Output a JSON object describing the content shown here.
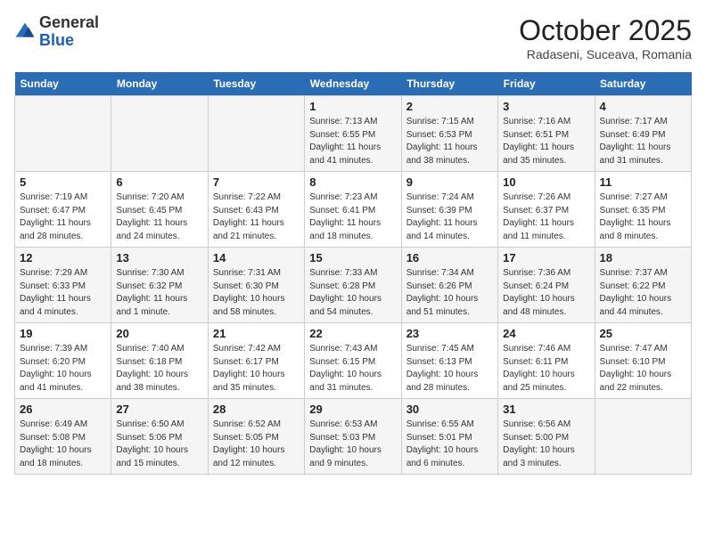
{
  "logo": {
    "general": "General",
    "blue": "Blue"
  },
  "header": {
    "month_title": "October 2025",
    "subtitle": "Radaseni, Suceava, Romania"
  },
  "weekdays": [
    "Sunday",
    "Monday",
    "Tuesday",
    "Wednesday",
    "Thursday",
    "Friday",
    "Saturday"
  ],
  "weeks": [
    [
      {
        "day": "",
        "info": ""
      },
      {
        "day": "",
        "info": ""
      },
      {
        "day": "",
        "info": ""
      },
      {
        "day": "1",
        "info": "Sunrise: 7:13 AM\nSunset: 6:55 PM\nDaylight: 11 hours\nand 41 minutes."
      },
      {
        "day": "2",
        "info": "Sunrise: 7:15 AM\nSunset: 6:53 PM\nDaylight: 11 hours\nand 38 minutes."
      },
      {
        "day": "3",
        "info": "Sunrise: 7:16 AM\nSunset: 6:51 PM\nDaylight: 11 hours\nand 35 minutes."
      },
      {
        "day": "4",
        "info": "Sunrise: 7:17 AM\nSunset: 6:49 PM\nDaylight: 11 hours\nand 31 minutes."
      }
    ],
    [
      {
        "day": "5",
        "info": "Sunrise: 7:19 AM\nSunset: 6:47 PM\nDaylight: 11 hours\nand 28 minutes."
      },
      {
        "day": "6",
        "info": "Sunrise: 7:20 AM\nSunset: 6:45 PM\nDaylight: 11 hours\nand 24 minutes."
      },
      {
        "day": "7",
        "info": "Sunrise: 7:22 AM\nSunset: 6:43 PM\nDaylight: 11 hours\nand 21 minutes."
      },
      {
        "day": "8",
        "info": "Sunrise: 7:23 AM\nSunset: 6:41 PM\nDaylight: 11 hours\nand 18 minutes."
      },
      {
        "day": "9",
        "info": "Sunrise: 7:24 AM\nSunset: 6:39 PM\nDaylight: 11 hours\nand 14 minutes."
      },
      {
        "day": "10",
        "info": "Sunrise: 7:26 AM\nSunset: 6:37 PM\nDaylight: 11 hours\nand 11 minutes."
      },
      {
        "day": "11",
        "info": "Sunrise: 7:27 AM\nSunset: 6:35 PM\nDaylight: 11 hours\nand 8 minutes."
      }
    ],
    [
      {
        "day": "12",
        "info": "Sunrise: 7:29 AM\nSunset: 6:33 PM\nDaylight: 11 hours\nand 4 minutes."
      },
      {
        "day": "13",
        "info": "Sunrise: 7:30 AM\nSunset: 6:32 PM\nDaylight: 11 hours\nand 1 minute."
      },
      {
        "day": "14",
        "info": "Sunrise: 7:31 AM\nSunset: 6:30 PM\nDaylight: 10 hours\nand 58 minutes."
      },
      {
        "day": "15",
        "info": "Sunrise: 7:33 AM\nSunset: 6:28 PM\nDaylight: 10 hours\nand 54 minutes."
      },
      {
        "day": "16",
        "info": "Sunrise: 7:34 AM\nSunset: 6:26 PM\nDaylight: 10 hours\nand 51 minutes."
      },
      {
        "day": "17",
        "info": "Sunrise: 7:36 AM\nSunset: 6:24 PM\nDaylight: 10 hours\nand 48 minutes."
      },
      {
        "day": "18",
        "info": "Sunrise: 7:37 AM\nSunset: 6:22 PM\nDaylight: 10 hours\nand 44 minutes."
      }
    ],
    [
      {
        "day": "19",
        "info": "Sunrise: 7:39 AM\nSunset: 6:20 PM\nDaylight: 10 hours\nand 41 minutes."
      },
      {
        "day": "20",
        "info": "Sunrise: 7:40 AM\nSunset: 6:18 PM\nDaylight: 10 hours\nand 38 minutes."
      },
      {
        "day": "21",
        "info": "Sunrise: 7:42 AM\nSunset: 6:17 PM\nDaylight: 10 hours\nand 35 minutes."
      },
      {
        "day": "22",
        "info": "Sunrise: 7:43 AM\nSunset: 6:15 PM\nDaylight: 10 hours\nand 31 minutes."
      },
      {
        "day": "23",
        "info": "Sunrise: 7:45 AM\nSunset: 6:13 PM\nDaylight: 10 hours\nand 28 minutes."
      },
      {
        "day": "24",
        "info": "Sunrise: 7:46 AM\nSunset: 6:11 PM\nDaylight: 10 hours\nand 25 minutes."
      },
      {
        "day": "25",
        "info": "Sunrise: 7:47 AM\nSunset: 6:10 PM\nDaylight: 10 hours\nand 22 minutes."
      }
    ],
    [
      {
        "day": "26",
        "info": "Sunrise: 6:49 AM\nSunset: 5:08 PM\nDaylight: 10 hours\nand 18 minutes."
      },
      {
        "day": "27",
        "info": "Sunrise: 6:50 AM\nSunset: 5:06 PM\nDaylight: 10 hours\nand 15 minutes."
      },
      {
        "day": "28",
        "info": "Sunrise: 6:52 AM\nSunset: 5:05 PM\nDaylight: 10 hours\nand 12 minutes."
      },
      {
        "day": "29",
        "info": "Sunrise: 6:53 AM\nSunset: 5:03 PM\nDaylight: 10 hours\nand 9 minutes."
      },
      {
        "day": "30",
        "info": "Sunrise: 6:55 AM\nSunset: 5:01 PM\nDaylight: 10 hours\nand 6 minutes."
      },
      {
        "day": "31",
        "info": "Sunrise: 6:56 AM\nSunset: 5:00 PM\nDaylight: 10 hours\nand 3 minutes."
      },
      {
        "day": "",
        "info": ""
      }
    ]
  ]
}
